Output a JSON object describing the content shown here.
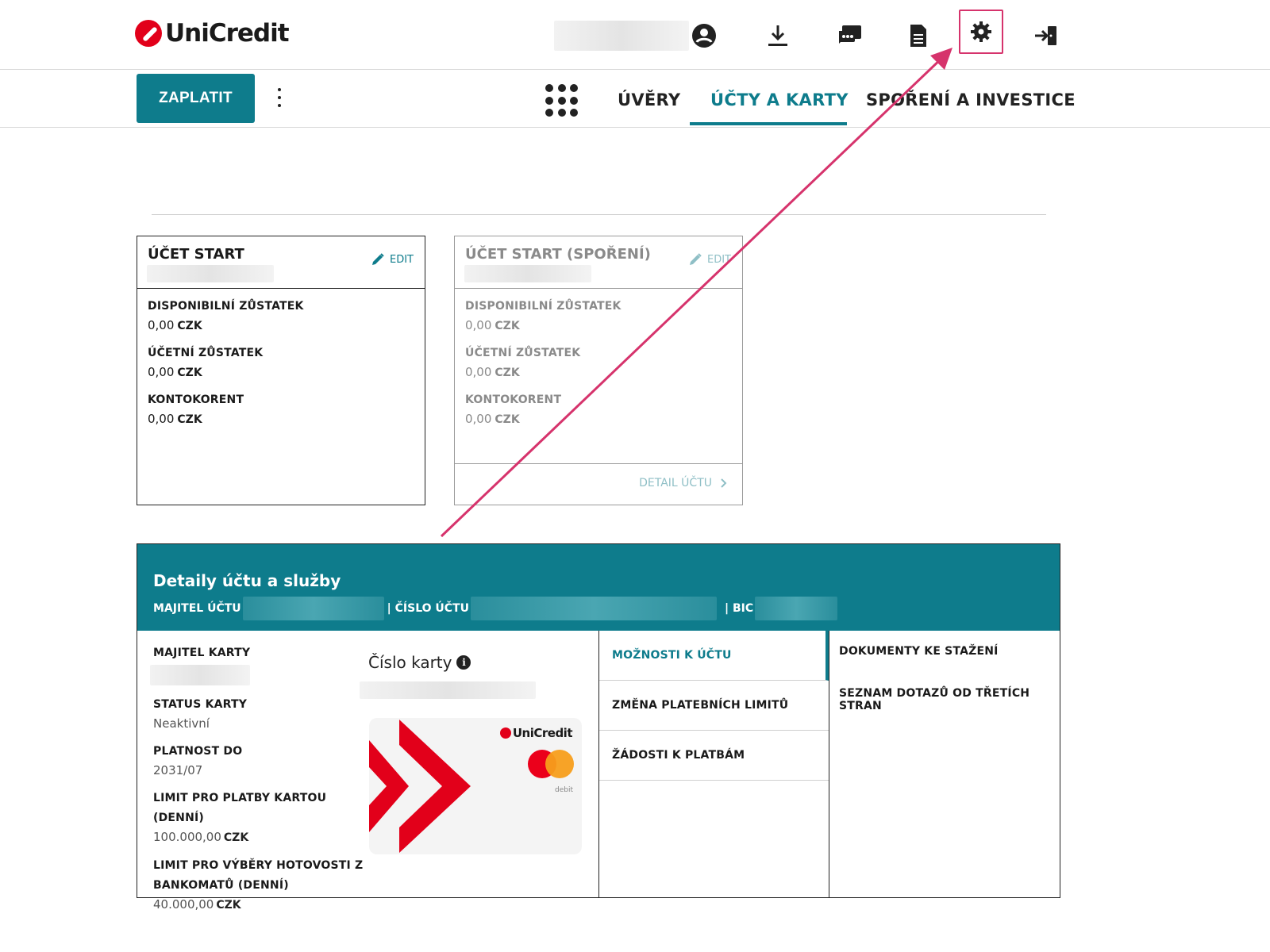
{
  "header": {
    "logo_text": "UniCredit",
    "icons": [
      "user-icon",
      "download-icon",
      "chat-icon",
      "document-icon",
      "gear-icon",
      "logout-icon"
    ],
    "highlight_color": "#d6336c"
  },
  "nav": {
    "pay_button": "ZAPLATIT",
    "tabs": [
      {
        "label": "ÚVĚRY",
        "active": false
      },
      {
        "label": "ÚČTY A KARTY",
        "active": true
      },
      {
        "label": "SPOŘENÍ A INVESTICE",
        "active": false
      }
    ],
    "accent_color": "#0e7c8c"
  },
  "accounts": [
    {
      "title": "ÚČET START",
      "edit_label": "EDIT",
      "rows": [
        {
          "label": "DISPONIBILNÍ ZŮSTATEK",
          "amount": "0,00",
          "currency": "CZK"
        },
        {
          "label": "ÚČETNÍ ZŮSTATEK",
          "amount": "0,00",
          "currency": "CZK"
        },
        {
          "label": "KONTOKORENT",
          "amount": "0,00",
          "currency": "CZK"
        }
      ]
    },
    {
      "title": "ÚČET START (SPOŘENÍ)",
      "edit_label": "EDIT",
      "detail_link": "DETAIL ÚČTU",
      "rows": [
        {
          "label": "DISPONIBILNÍ ZŮSTATEK",
          "amount": "0,00",
          "currency": "CZK"
        },
        {
          "label": "ÚČETNÍ ZŮSTATEK",
          "amount": "0,00",
          "currency": "CZK"
        },
        {
          "label": "KONTOKORENT",
          "amount": "0,00",
          "currency": "CZK"
        }
      ]
    }
  ],
  "details": {
    "title": "Detaily účtu a služby",
    "owner_label": "MAJITEL ÚČTU",
    "account_number_label": "| ČÍSLO ÚČTU",
    "bic_label": "| BIC",
    "card": {
      "holder_label": "MAJITEL KARTY",
      "status_label": "STATUS KARTY",
      "status_value": "Neaktivní",
      "validity_label": "PLATNOST DO",
      "validity_value": "2031/07",
      "card_limit_label": "LIMIT PRO PLATBY KARTOU (DENNÍ)",
      "card_limit_amount": "100.000,00",
      "card_limit_currency": "CZK",
      "atm_limit_label": "LIMIT PRO VÝBĚRY HOTOVOSTI Z BANKOMATŮ (DENNÍ)",
      "atm_limit_amount": "40.000,00",
      "atm_limit_currency": "CZK",
      "number_title": "Číslo karty",
      "card_logo": "UniCredit",
      "card_type": "debit"
    },
    "options": [
      {
        "label": "MOŽNOSTI K ÚČTU",
        "active": true
      },
      {
        "label": "ZMĚNA PLATEBNÍCH LIMITŮ",
        "active": false
      },
      {
        "label": "ŽÁDOSTI K PLATBÁM",
        "active": false
      }
    ],
    "documents": [
      {
        "label": "DOKUMENTY KE STAŽENÍ"
      },
      {
        "label": "SEZNAM DOTAZŮ OD TŘETÍCH STRAN"
      }
    ]
  }
}
